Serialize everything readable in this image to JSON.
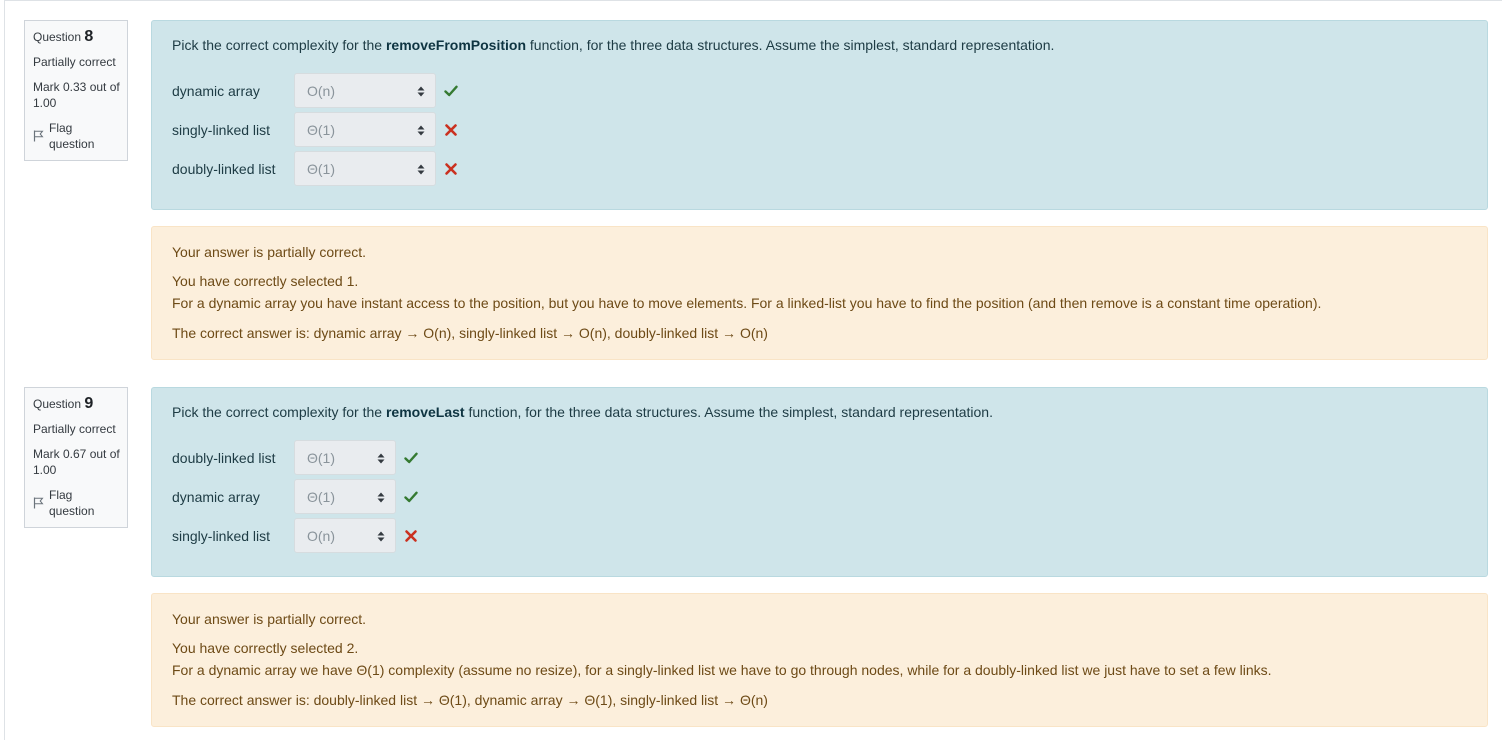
{
  "questions": [
    {
      "label": "Question",
      "number": "8",
      "state": "Partially correct",
      "grade": "Mark 0.33 out of 1.00",
      "flag_label": "Flag question",
      "text_before": "Pick the correct complexity for the ",
      "function_name": "removeFromPosition",
      "text_after": " function, for the three data structures. Assume the simplest, standard representation.",
      "rows": [
        {
          "label": "dynamic array",
          "selected": "O(n)",
          "correct": true
        },
        {
          "label": "singly-linked list",
          "selected": "Θ(1)",
          "correct": false
        },
        {
          "label": "doubly-linked list",
          "selected": "Θ(1)",
          "correct": false
        }
      ],
      "feedback": {
        "summary": "Your answer is partially correct.",
        "selected_count": "You have correctly selected 1.",
        "explanation": "For a dynamic array you have instant access to the position, but you have to move elements. For a linked-list you have to find the position (and then remove is a constant time operation).",
        "correct_answer": "The correct answer is: dynamic array → O(n), singly-linked list → O(n), doubly-linked list → O(n)"
      }
    },
    {
      "label": "Question",
      "number": "9",
      "state": "Partially correct",
      "grade": "Mark 0.67 out of 1.00",
      "flag_label": "Flag question",
      "text_before": "Pick the correct complexity for the ",
      "function_name": "removeLast",
      "text_after": " function, for the three data structures. Assume the simplest, standard representation.",
      "rows": [
        {
          "label": "doubly-linked list",
          "selected": "Θ(1)",
          "correct": true
        },
        {
          "label": "dynamic array",
          "selected": "Θ(1)",
          "correct": true
        },
        {
          "label": "singly-linked list",
          "selected": "O(n)",
          "correct": false
        }
      ],
      "feedback": {
        "summary": "Your answer is partially correct.",
        "selected_count": "You have correctly selected 2.",
        "explanation": "For a dynamic array we have Θ(1) complexity (assume no resize), for a singly-linked list we have to go through nodes, while for a doubly-linked list we just have to set a few links.",
        "correct_answer": "The correct answer is: doubly-linked list → Θ(1), dynamic array → Θ(1), singly-linked list → Θ(n)"
      }
    }
  ],
  "colors": {
    "correct": "#357a32",
    "incorrect": "#ca3120",
    "formulation_bg": "#cfe5ea",
    "feedback_bg": "#fcefdc"
  },
  "icons": {
    "flag": "flag-outline-icon",
    "correct": "check-icon",
    "incorrect": "cross-icon",
    "select_arrow": "sort-arrows-icon"
  }
}
